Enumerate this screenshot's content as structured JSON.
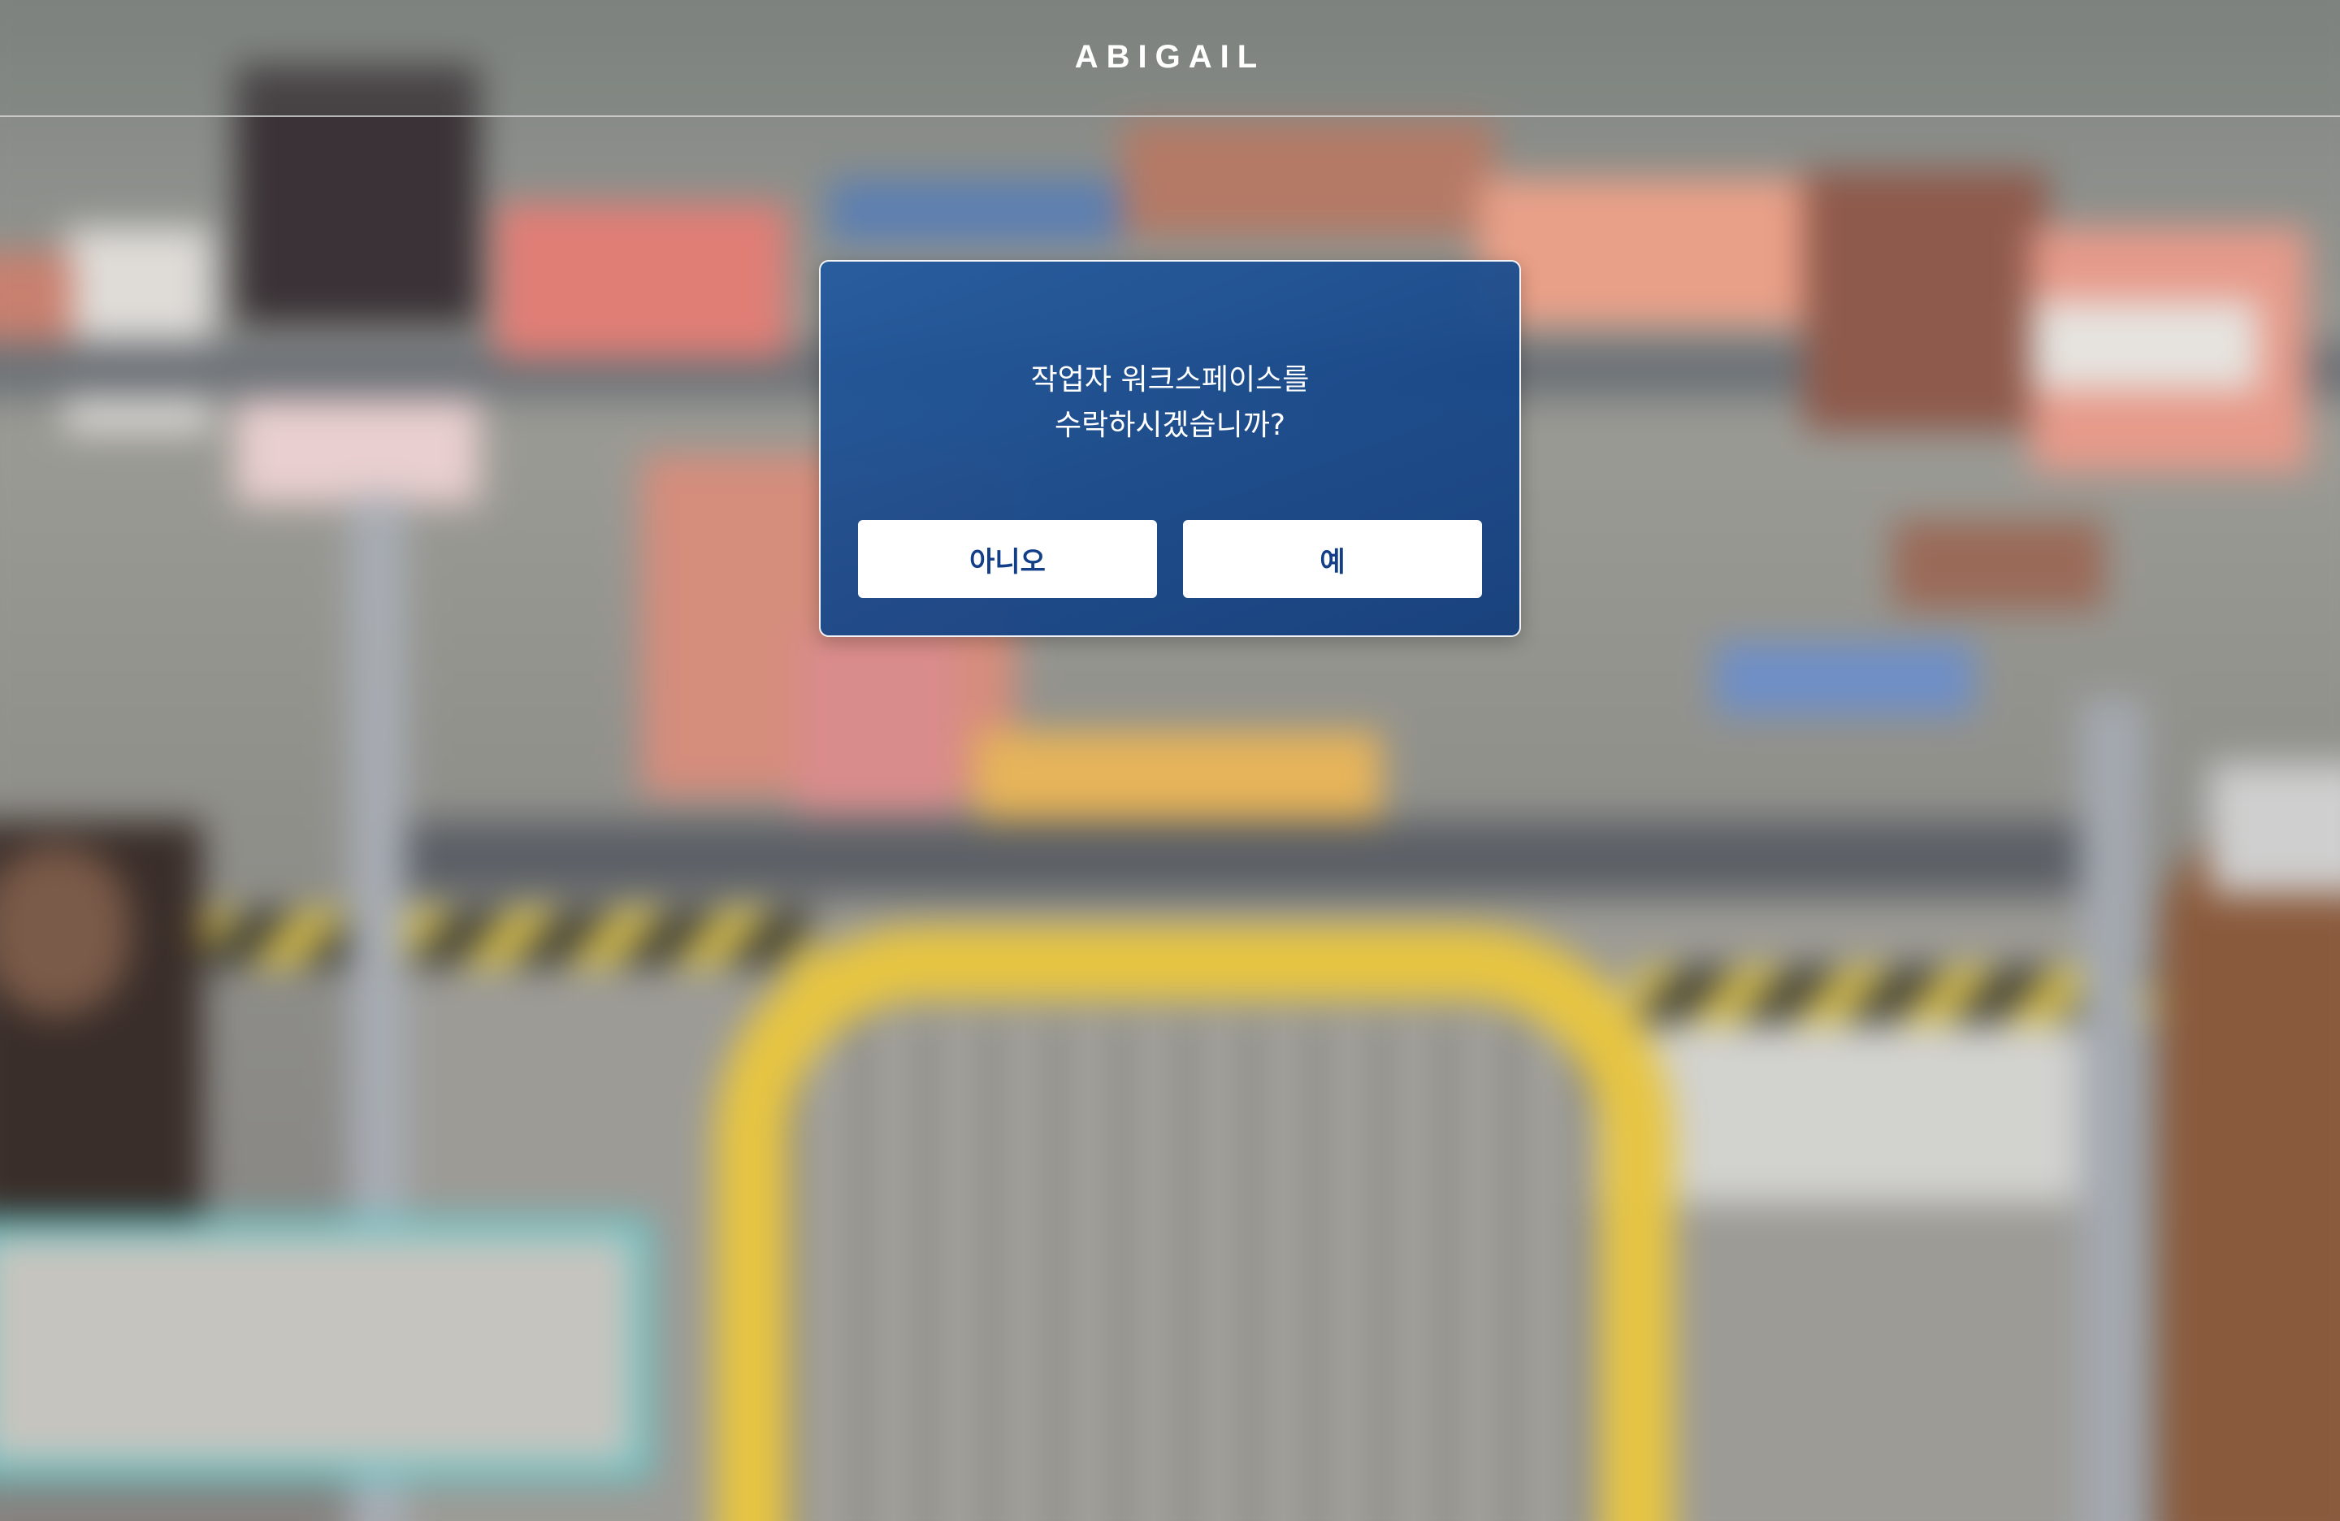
{
  "header": {
    "title": "ABIGAIL"
  },
  "dialog": {
    "message_line1": "작업자 워크스페이스를",
    "message_line2": "수락하시겠습니까?",
    "no_label": "아니오",
    "yes_label": "예"
  },
  "colors": {
    "dialog_background": "#1f4f93",
    "button_background": "#ffffff",
    "button_text": "#123f88",
    "title_text": "#ffffff"
  }
}
